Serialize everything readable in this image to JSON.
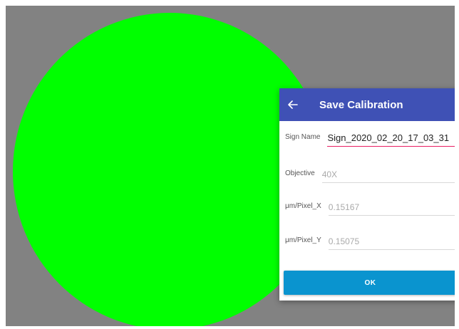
{
  "dialog": {
    "title": "Save Calibration",
    "back_icon": "arrow-left-icon",
    "header_color": "#3f51b5",
    "fields": [
      {
        "label": "Sign Name",
        "value": "Sign_2020_02_20_17_03_31"
      },
      {
        "label": "Objective",
        "value": "40X"
      },
      {
        "label": "μm/Pixel_X",
        "value": "0.15167"
      },
      {
        "label": "μm/Pixel_Y",
        "value": "0.15075"
      }
    ],
    "ok_label": "OK",
    "ok_color": "#0a94cf"
  },
  "background": {
    "screen_color": "#828282",
    "circle_color": "#00ff00"
  }
}
